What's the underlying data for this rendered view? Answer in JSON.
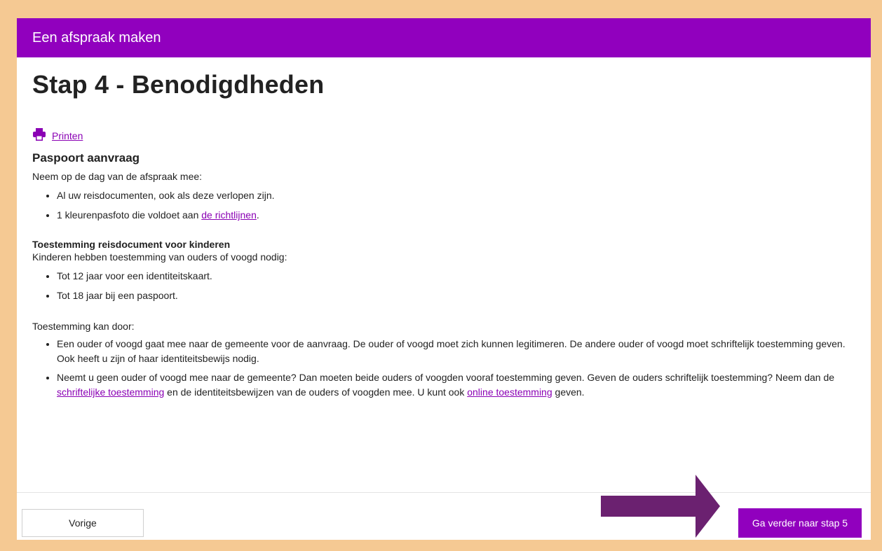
{
  "header": {
    "title": "Een afspraak maken"
  },
  "page": {
    "heading": "Stap 4 - Benodigdheden"
  },
  "print": {
    "label": "Printen",
    "icon": "printer-icon"
  },
  "passport": {
    "heading": "Paspoort aanvraag",
    "intro": "Neem op de dag van de afspraak mee:",
    "item1": "Al uw reisdocumenten, ook als deze verlopen zijn.",
    "item2_text": "1 kleurenpasfoto die voldoet aan ",
    "item2_link": "de richtlijnen",
    "item2_end": "."
  },
  "consent": {
    "heading": "Toestemming reisdocument voor kinderen",
    "intro": "Kinderen hebben toestemming van ouders of voogd nodig:",
    "item1": "Tot 12 jaar voor een identiteitskaart.",
    "item2": "Tot 18 jaar bij een paspoort.",
    "how_intro": "Toestemming kan door:",
    "how1": "Een ouder of voogd gaat mee naar de gemeente voor de aanvraag. De ouder of voogd moet zich kunnen legitimeren. De andere ouder of voogd moet schriftelijk toestemming geven. Ook heeft u zijn of haar identiteitsbewijs nodig.",
    "how2_a": "Neemt u geen ouder of voogd mee naar de gemeente? Dan moeten beide ouders of voogden vooraf toestemming geven. Geven de ouders schriftelijk toestemming? Neem dan de ",
    "how2_link1": "schriftelijke toestemming",
    "how2_b": " en de identiteitsbewijzen van de ouders of voogden mee. U kunt ook ",
    "how2_link2": "online toestemming",
    "how2_c": " geven."
  },
  "footer": {
    "prev_label": "Vorige",
    "next_label": "Ga verder naar stap 5"
  },
  "colors": {
    "brand": "#9100be",
    "background": "#f5c993",
    "link": "#8a00b4",
    "arrow": "#6b2170"
  }
}
